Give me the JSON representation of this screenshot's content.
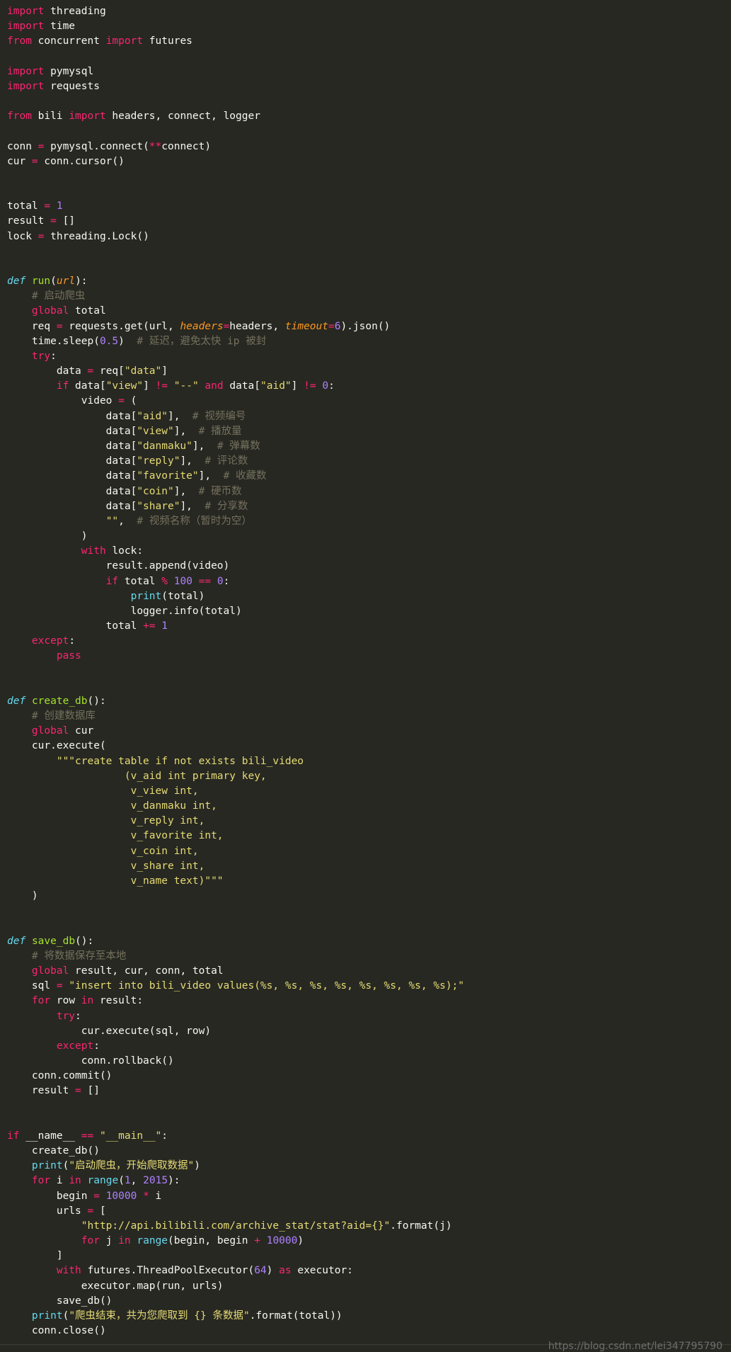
{
  "editor": {
    "background": "#272822",
    "lines": [
      [
        [
          "kw",
          "import"
        ],
        [
          "pl",
          " threading"
        ]
      ],
      [
        [
          "kw",
          "import"
        ],
        [
          "pl",
          " time"
        ]
      ],
      [
        [
          "kw",
          "from"
        ],
        [
          "pl",
          " concurrent "
        ],
        [
          "kw",
          "import"
        ],
        [
          "pl",
          " futures"
        ]
      ],
      [],
      [
        [
          "kw",
          "import"
        ],
        [
          "pl",
          " pymysql"
        ]
      ],
      [
        [
          "kw",
          "import"
        ],
        [
          "pl",
          " requests"
        ]
      ],
      [],
      [
        [
          "kw",
          "from"
        ],
        [
          "pl",
          " bili "
        ],
        [
          "kw",
          "import"
        ],
        [
          "pl",
          " headers, connect, logger"
        ]
      ],
      [],
      [
        [
          "pl",
          "conn "
        ],
        [
          "op",
          "="
        ],
        [
          "pl",
          " pymysql.connect("
        ],
        [
          "op",
          "**"
        ],
        [
          "pl",
          "connect)"
        ]
      ],
      [
        [
          "pl",
          "cur "
        ],
        [
          "op",
          "="
        ],
        [
          "pl",
          " conn.cursor()"
        ]
      ],
      [],
      [],
      [
        [
          "pl",
          "total "
        ],
        [
          "op",
          "="
        ],
        [
          "pl",
          " "
        ],
        [
          "num",
          "1"
        ]
      ],
      [
        [
          "pl",
          "result "
        ],
        [
          "op",
          "="
        ],
        [
          "pl",
          " []"
        ]
      ],
      [
        [
          "pl",
          "lock "
        ],
        [
          "op",
          "="
        ],
        [
          "pl",
          " threading.Lock()"
        ]
      ],
      [],
      [],
      [
        [
          "def",
          "def"
        ],
        [
          "pl",
          " "
        ],
        [
          "fn",
          "run"
        ],
        [
          "pl",
          "("
        ],
        [
          "param",
          "url"
        ],
        [
          "pl",
          "):"
        ]
      ],
      [
        [
          "pl",
          "    "
        ],
        [
          "cm",
          "# 启动爬虫"
        ]
      ],
      [
        [
          "pl",
          "    "
        ],
        [
          "kw",
          "global"
        ],
        [
          "pl",
          " total"
        ]
      ],
      [
        [
          "pl",
          "    req "
        ],
        [
          "op",
          "="
        ],
        [
          "pl",
          " requests.get(url, "
        ],
        [
          "param",
          "headers"
        ],
        [
          "op",
          "="
        ],
        [
          "pl",
          "headers, "
        ],
        [
          "param",
          "timeout"
        ],
        [
          "op",
          "="
        ],
        [
          "num",
          "6"
        ],
        [
          "pl",
          ").json()"
        ]
      ],
      [
        [
          "pl",
          "    time.sleep("
        ],
        [
          "num",
          "0.5"
        ],
        [
          "pl",
          ")  "
        ],
        [
          "cm",
          "# 延迟，避免太快 ip 被封"
        ]
      ],
      [
        [
          "pl",
          "    "
        ],
        [
          "kw",
          "try"
        ],
        [
          "pl",
          ":"
        ]
      ],
      [
        [
          "pl",
          "        data "
        ],
        [
          "op",
          "="
        ],
        [
          "pl",
          " req["
        ],
        [
          "str",
          "\"data\""
        ],
        [
          "pl",
          "]"
        ]
      ],
      [
        [
          "pl",
          "        "
        ],
        [
          "kw",
          "if"
        ],
        [
          "pl",
          " data["
        ],
        [
          "str",
          "\"view\""
        ],
        [
          "pl",
          "] "
        ],
        [
          "op",
          "!="
        ],
        [
          "pl",
          " "
        ],
        [
          "str",
          "\"--\""
        ],
        [
          "pl",
          " "
        ],
        [
          "kw",
          "and"
        ],
        [
          "pl",
          " data["
        ],
        [
          "str",
          "\"aid\""
        ],
        [
          "pl",
          "] "
        ],
        [
          "op",
          "!="
        ],
        [
          "pl",
          " "
        ],
        [
          "num",
          "0"
        ],
        [
          "pl",
          ":"
        ]
      ],
      [
        [
          "pl",
          "            video "
        ],
        [
          "op",
          "="
        ],
        [
          "pl",
          " ("
        ]
      ],
      [
        [
          "pl",
          "                data["
        ],
        [
          "str",
          "\"aid\""
        ],
        [
          "pl",
          "],  "
        ],
        [
          "cm",
          "# 视频编号"
        ]
      ],
      [
        [
          "pl",
          "                data["
        ],
        [
          "str",
          "\"view\""
        ],
        [
          "pl",
          "],  "
        ],
        [
          "cm",
          "# 播放量"
        ]
      ],
      [
        [
          "pl",
          "                data["
        ],
        [
          "str",
          "\"danmaku\""
        ],
        [
          "pl",
          "],  "
        ],
        [
          "cm",
          "# 弹幕数"
        ]
      ],
      [
        [
          "pl",
          "                data["
        ],
        [
          "str",
          "\"reply\""
        ],
        [
          "pl",
          "],  "
        ],
        [
          "cm",
          "# 评论数"
        ]
      ],
      [
        [
          "pl",
          "                data["
        ],
        [
          "str",
          "\"favorite\""
        ],
        [
          "pl",
          "],  "
        ],
        [
          "cm",
          "# 收藏数"
        ]
      ],
      [
        [
          "pl",
          "                data["
        ],
        [
          "str",
          "\"coin\""
        ],
        [
          "pl",
          "],  "
        ],
        [
          "cm",
          "# 硬币数"
        ]
      ],
      [
        [
          "pl",
          "                data["
        ],
        [
          "str",
          "\"share\""
        ],
        [
          "pl",
          "],  "
        ],
        [
          "cm",
          "# 分享数"
        ]
      ],
      [
        [
          "pl",
          "                "
        ],
        [
          "str",
          "\"\""
        ],
        [
          "pl",
          ",  "
        ],
        [
          "cm",
          "# 视频名称（暂时为空）"
        ]
      ],
      [
        [
          "pl",
          "            )"
        ]
      ],
      [
        [
          "pl",
          "            "
        ],
        [
          "kw",
          "with"
        ],
        [
          "pl",
          " lock:"
        ]
      ],
      [
        [
          "pl",
          "                result.append(video)"
        ]
      ],
      [
        [
          "pl",
          "                "
        ],
        [
          "kw",
          "if"
        ],
        [
          "pl",
          " total "
        ],
        [
          "op",
          "%"
        ],
        [
          "pl",
          " "
        ],
        [
          "num",
          "100"
        ],
        [
          "pl",
          " "
        ],
        [
          "op",
          "=="
        ],
        [
          "pl",
          " "
        ],
        [
          "num",
          "0"
        ],
        [
          "pl",
          ":"
        ]
      ],
      [
        [
          "pl",
          "                    "
        ],
        [
          "bi",
          "print"
        ],
        [
          "pl",
          "(total)"
        ]
      ],
      [
        [
          "pl",
          "                    logger.info(total)"
        ]
      ],
      [
        [
          "pl",
          "                total "
        ],
        [
          "op",
          "+="
        ],
        [
          "pl",
          " "
        ],
        [
          "num",
          "1"
        ]
      ],
      [
        [
          "pl",
          "    "
        ],
        [
          "kw",
          "except"
        ],
        [
          "pl",
          ":"
        ]
      ],
      [
        [
          "pl",
          "        "
        ],
        [
          "kw",
          "pass"
        ]
      ],
      [],
      [],
      [
        [
          "def",
          "def"
        ],
        [
          "pl",
          " "
        ],
        [
          "fn",
          "create_db"
        ],
        [
          "pl",
          "():"
        ]
      ],
      [
        [
          "pl",
          "    "
        ],
        [
          "cm",
          "# 创建数据库"
        ]
      ],
      [
        [
          "pl",
          "    "
        ],
        [
          "kw",
          "global"
        ],
        [
          "pl",
          " cur"
        ]
      ],
      [
        [
          "pl",
          "    cur.execute("
        ]
      ],
      [
        [
          "pl",
          "        "
        ],
        [
          "str",
          "\"\"\"create table if not exists bili_video"
        ]
      ],
      [
        [
          "str",
          "                   (v_aid int primary key,"
        ]
      ],
      [
        [
          "str",
          "                    v_view int,"
        ]
      ],
      [
        [
          "str",
          "                    v_danmaku int,"
        ]
      ],
      [
        [
          "str",
          "                    v_reply int,"
        ]
      ],
      [
        [
          "str",
          "                    v_favorite int,"
        ]
      ],
      [
        [
          "str",
          "                    v_coin int,"
        ]
      ],
      [
        [
          "str",
          "                    v_share int,"
        ]
      ],
      [
        [
          "str",
          "                    v_name text)\"\"\""
        ]
      ],
      [
        [
          "pl",
          "    )"
        ]
      ],
      [],
      [],
      [
        [
          "def",
          "def"
        ],
        [
          "pl",
          " "
        ],
        [
          "fn",
          "save_db"
        ],
        [
          "pl",
          "():"
        ]
      ],
      [
        [
          "pl",
          "    "
        ],
        [
          "cm",
          "# 将数据保存至本地"
        ]
      ],
      [
        [
          "pl",
          "    "
        ],
        [
          "kw",
          "global"
        ],
        [
          "pl",
          " result, cur, conn, total"
        ]
      ],
      [
        [
          "pl",
          "    sql "
        ],
        [
          "op",
          "="
        ],
        [
          "pl",
          " "
        ],
        [
          "str",
          "\"insert into bili_video values(%s, %s, %s, %s, %s, %s, %s, %s);\""
        ]
      ],
      [
        [
          "pl",
          "    "
        ],
        [
          "kw",
          "for"
        ],
        [
          "pl",
          " row "
        ],
        [
          "kw",
          "in"
        ],
        [
          "pl",
          " result:"
        ]
      ],
      [
        [
          "pl",
          "        "
        ],
        [
          "kw",
          "try"
        ],
        [
          "pl",
          ":"
        ]
      ],
      [
        [
          "pl",
          "            cur.execute(sql, row)"
        ]
      ],
      [
        [
          "pl",
          "        "
        ],
        [
          "kw",
          "except"
        ],
        [
          "pl",
          ":"
        ]
      ],
      [
        [
          "pl",
          "            conn.rollback()"
        ]
      ],
      [
        [
          "pl",
          "    conn.commit()"
        ]
      ],
      [
        [
          "pl",
          "    result "
        ],
        [
          "op",
          "="
        ],
        [
          "pl",
          " []"
        ]
      ],
      [],
      [],
      [
        [
          "kw",
          "if"
        ],
        [
          "pl",
          " __name__ "
        ],
        [
          "op",
          "=="
        ],
        [
          "pl",
          " "
        ],
        [
          "str",
          "\"__main__\""
        ],
        [
          "pl",
          ":"
        ]
      ],
      [
        [
          "pl",
          "    create_db()"
        ]
      ],
      [
        [
          "pl",
          "    "
        ],
        [
          "bi",
          "print"
        ],
        [
          "pl",
          "("
        ],
        [
          "str",
          "\"启动爬虫，开始爬取数据\""
        ],
        [
          "pl",
          ")"
        ]
      ],
      [
        [
          "pl",
          "    "
        ],
        [
          "kw",
          "for"
        ],
        [
          "pl",
          " i "
        ],
        [
          "kw",
          "in"
        ],
        [
          "pl",
          " "
        ],
        [
          "bi",
          "range"
        ],
        [
          "pl",
          "("
        ],
        [
          "num",
          "1"
        ],
        [
          "pl",
          ", "
        ],
        [
          "num",
          "2015"
        ],
        [
          "pl",
          "):"
        ]
      ],
      [
        [
          "pl",
          "        begin "
        ],
        [
          "op",
          "="
        ],
        [
          "pl",
          " "
        ],
        [
          "num",
          "10000"
        ],
        [
          "pl",
          " "
        ],
        [
          "op",
          "*"
        ],
        [
          "pl",
          " i"
        ]
      ],
      [
        [
          "pl",
          "        urls "
        ],
        [
          "op",
          "="
        ],
        [
          "pl",
          " ["
        ]
      ],
      [
        [
          "pl",
          "            "
        ],
        [
          "str",
          "\"http://api.bilibili.com/archive_stat/stat?aid={}\""
        ],
        [
          "pl",
          ".format(j)"
        ]
      ],
      [
        [
          "pl",
          "            "
        ],
        [
          "kw",
          "for"
        ],
        [
          "pl",
          " j "
        ],
        [
          "kw",
          "in"
        ],
        [
          "pl",
          " "
        ],
        [
          "bi",
          "range"
        ],
        [
          "pl",
          "(begin, begin "
        ],
        [
          "op",
          "+"
        ],
        [
          "pl",
          " "
        ],
        [
          "num",
          "10000"
        ],
        [
          "pl",
          ")"
        ]
      ],
      [
        [
          "pl",
          "        ]"
        ]
      ],
      [
        [
          "pl",
          "        "
        ],
        [
          "kw",
          "with"
        ],
        [
          "pl",
          " futures.ThreadPoolExecutor("
        ],
        [
          "num",
          "64"
        ],
        [
          "pl",
          ") "
        ],
        [
          "kw",
          "as"
        ],
        [
          "pl",
          " executor:"
        ]
      ],
      [
        [
          "pl",
          "            executor.map(run, urls)"
        ]
      ],
      [
        [
          "pl",
          "        save_db()"
        ]
      ],
      [
        [
          "pl",
          "    "
        ],
        [
          "bi",
          "print"
        ],
        [
          "pl",
          "("
        ],
        [
          "str",
          "\"爬虫结束，共为您爬取到 {} 条数据\""
        ],
        [
          "pl",
          ".format(total))"
        ]
      ],
      [
        [
          "pl",
          "    conn.close()"
        ]
      ]
    ]
  },
  "watermark": {
    "text": "https://blog.csdn.net/lei347795790"
  }
}
